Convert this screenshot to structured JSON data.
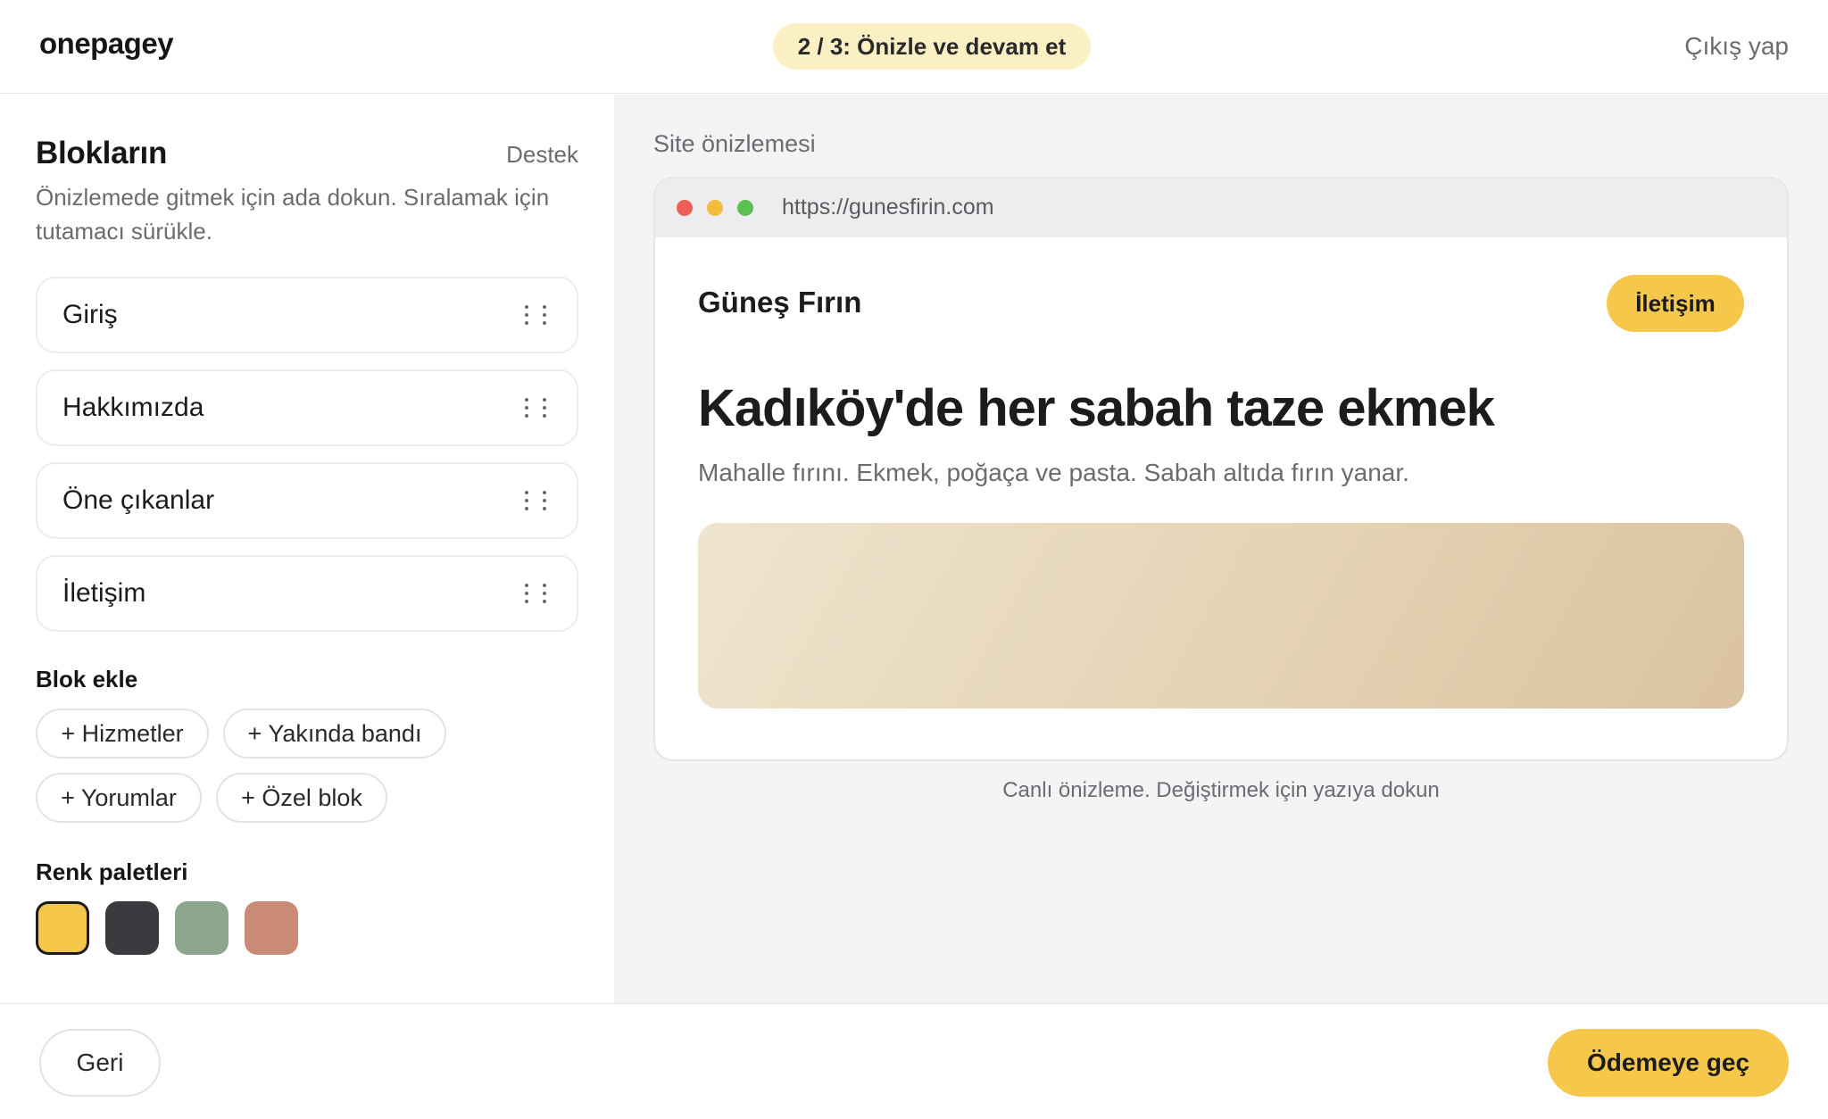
{
  "header": {
    "brand": "onepagey",
    "step": "2 / 3: Önizle ve devam et",
    "logout": "Çıkış yap"
  },
  "blocks_panel": {
    "title": "Blokların",
    "support": "Destek",
    "hint": "Önizlemede gitmek için ada dokun. Sıralamak için tutamacı sürükle.",
    "items": [
      {
        "label": "Giriş"
      },
      {
        "label": "Hakkımızda"
      },
      {
        "label": "Öne çıkanlar"
      },
      {
        "label": "İletişim"
      }
    ],
    "add_title": "Blok ekle",
    "add_options": [
      {
        "label": "+ Hizmetler"
      },
      {
        "label": "+ Yakında bandı"
      },
      {
        "label": "+ Yorumlar"
      },
      {
        "label": "+ Özel blok"
      }
    ],
    "palette_title": "Renk paletleri",
    "palettes": [
      {
        "color": "#f5c84b",
        "selected": true
      },
      {
        "color": "#3a3a3f",
        "selected": false
      },
      {
        "color": "#8fa68e",
        "selected": false
      },
      {
        "color": "#c98b78",
        "selected": false
      }
    ]
  },
  "preview": {
    "label": "Site önizlemesi",
    "url": "https://gunesfirin.com",
    "site_name": "Güneş Fırın",
    "cta": "İletişim",
    "headline": "Kadıköy'de her sabah taze ekmek",
    "subtext": "Mahalle fırını. Ekmek, poğaça ve pasta. Sabah altıda fırın yanar.",
    "caption": "Canlı önizleme. Değiştirmek için yazıya dokun"
  },
  "footer": {
    "back": "Geri",
    "checkout": "Ödemeye geç"
  },
  "colors": {
    "accent": "#f5c84b",
    "traffic_red": "#ec5f56",
    "traffic_yellow": "#f4bd3c",
    "traffic_green": "#5dc152"
  }
}
